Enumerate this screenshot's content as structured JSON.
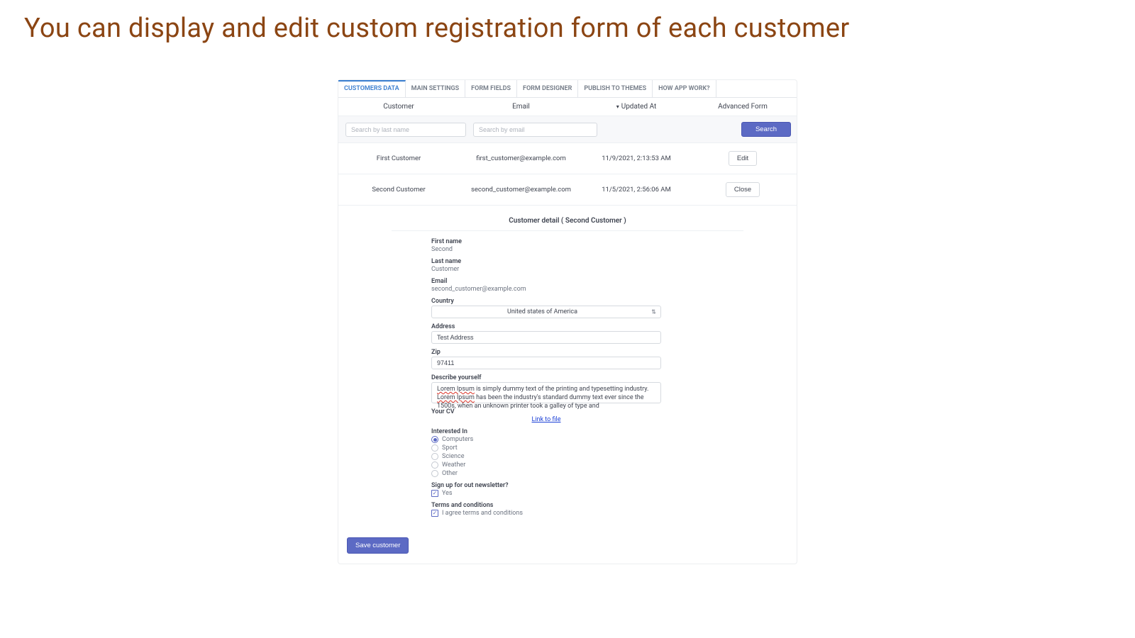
{
  "title": "You can display and edit custom registration form of each customer",
  "tabs": [
    {
      "label": "CUSTOMERS DATA",
      "active": true
    },
    {
      "label": "MAIN SETTINGS"
    },
    {
      "label": "FORM FIELDS"
    },
    {
      "label": "FORM DESIGNER"
    },
    {
      "label": "PUBLISH TO THEMES"
    },
    {
      "label": "HOW APP WORK?"
    }
  ],
  "columns": {
    "customer": "Customer",
    "email": "Email",
    "updated": "Updated At",
    "advanced": "Advanced Form"
  },
  "search": {
    "ph_lastname": "Search by last name",
    "ph_email": "Search by email",
    "button": "Search"
  },
  "rows": [
    {
      "name": "First Customer",
      "email": "first_customer@example.com",
      "updated": "11/9/2021, 2:13:53 AM",
      "action": "Edit"
    },
    {
      "name": "Second Customer",
      "email": "second_customer@example.com",
      "updated": "11/5/2021, 2:56:06 AM",
      "action": "Close"
    }
  ],
  "detail": {
    "heading": "Customer detail ( Second Customer )",
    "first_name_label": "First name",
    "first_name_value": "Second",
    "last_name_label": "Last name",
    "last_name_value": "Customer",
    "email_label": "Email",
    "email_value": "second_customer@example.com",
    "country_label": "Country",
    "country_value": "United states of America",
    "address_label": "Address",
    "address_value": "Test Address",
    "zip_label": "Zip",
    "zip_value": "97411",
    "describe_label": "Describe yourself",
    "describe_value_p1": "Lorem Ipsum",
    "describe_value_p2": " is simply dummy text of the printing and typesetting industry. ",
    "describe_value_p3": "Lorem Ipsum",
    "describe_value_p4": " has been the industry's standard dummy text ever since the 1500s, when an unknown printer took a galley of type and",
    "cv_label": "Your CV",
    "cv_link": "Link to file",
    "interested_label": "Interested In",
    "interests": [
      {
        "label": "Computers",
        "checked": true
      },
      {
        "label": "Sport",
        "checked": false
      },
      {
        "label": "Science",
        "checked": false
      },
      {
        "label": "Weather",
        "checked": false
      },
      {
        "label": "Other",
        "checked": false
      }
    ],
    "newsletter_label": "Sign up for out newsletter?",
    "newsletter_opt": "Yes",
    "terms_label": "Terms and conditions",
    "terms_opt": "I agree terms and conditions"
  },
  "save_button": "Save customer",
  "colors": {
    "accent": "#5c6ac4",
    "title_brown": "#8b4513"
  }
}
